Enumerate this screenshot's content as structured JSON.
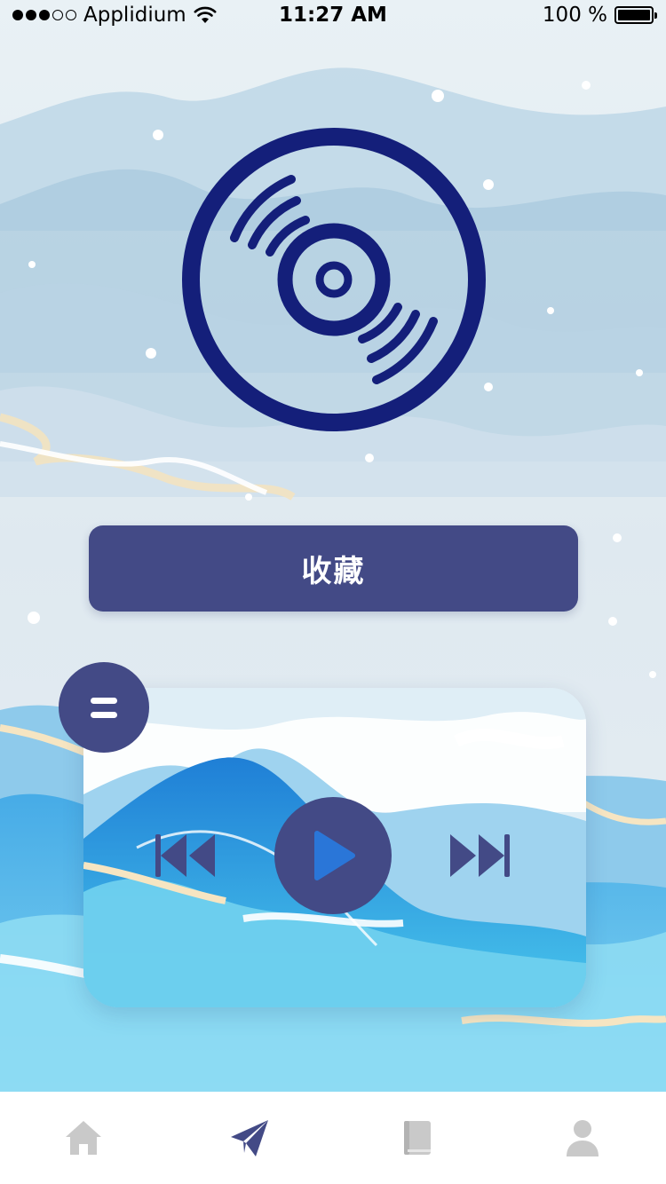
{
  "status_bar": {
    "carrier": "Applidium",
    "time": "11:27 AM",
    "battery": "100 %",
    "signal_icon": "signal-dots-icon",
    "wifi_icon": "wifi-icon",
    "battery_icon": "battery-icon"
  },
  "disc": {
    "icon": "vinyl-disc-icon",
    "color": "#141f7a"
  },
  "favorite_button": {
    "label": "收藏"
  },
  "player": {
    "menu_icon": "menu-icon",
    "prev_icon": "skip-previous-icon",
    "play_icon": "play-icon",
    "next_icon": "skip-next-icon",
    "accent": "#434a86"
  },
  "tab_bar": {
    "tabs": [
      {
        "icon": "home-icon",
        "active": false
      },
      {
        "icon": "paper-plane-icon",
        "active": true
      },
      {
        "icon": "book-icon",
        "active": false
      },
      {
        "icon": "user-icon",
        "active": false
      }
    ],
    "active_color": "#434a86",
    "inactive_color": "#c9c9c9"
  }
}
